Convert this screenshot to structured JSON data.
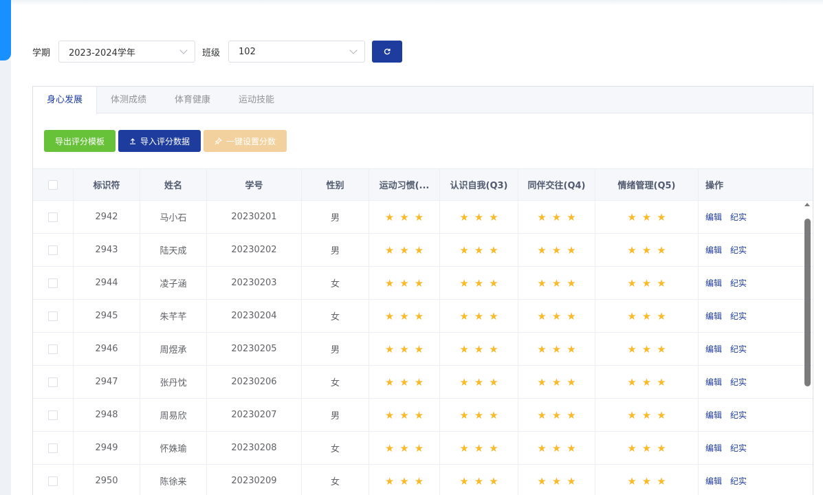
{
  "filters": {
    "term_label": "学期",
    "term_value": "2023-2024学年",
    "class_label": "班级",
    "class_value": "102",
    "refresh_icon": "refresh-icon"
  },
  "tabs": [
    {
      "label": "身心发展",
      "active": true
    },
    {
      "label": "体测成绩",
      "active": false
    },
    {
      "label": "体育健康",
      "active": false
    },
    {
      "label": "运动技能",
      "active": false
    }
  ],
  "actions": {
    "export_label": "导出评分模板",
    "import_label": "导入评分数据",
    "bulk_label": "一键设置分数"
  },
  "table": {
    "headers": [
      "标识符",
      "姓名",
      "学号",
      "性别",
      "运动习惯(...",
      "认识自我(Q3)",
      "同伴交往(Q4)",
      "情绪管理(Q5)",
      "操作"
    ],
    "edit_label": "编辑",
    "record_label": "纪实",
    "rows": [
      {
        "id": "2942",
        "name": "马小石",
        "sno": "20230201",
        "gender": "男",
        "q2": 3,
        "q3": 3,
        "q4": 3,
        "q5": 3
      },
      {
        "id": "2943",
        "name": "陆天成",
        "sno": "20230202",
        "gender": "男",
        "q2": 3,
        "q3": 3,
        "q4": 3,
        "q5": 3
      },
      {
        "id": "2944",
        "name": "凌子涵",
        "sno": "20230203",
        "gender": "女",
        "q2": 3,
        "q3": 3,
        "q4": 3,
        "q5": 3
      },
      {
        "id": "2945",
        "name": "朱芊芊",
        "sno": "20230204",
        "gender": "女",
        "q2": 3,
        "q3": 3,
        "q4": 3,
        "q5": 3
      },
      {
        "id": "2946",
        "name": "周煜承",
        "sno": "20230205",
        "gender": "男",
        "q2": 3,
        "q3": 3,
        "q4": 3,
        "q5": 3
      },
      {
        "id": "2947",
        "name": "张丹忱",
        "sno": "20230206",
        "gender": "女",
        "q2": 3,
        "q3": 3,
        "q4": 3,
        "q5": 3
      },
      {
        "id": "2948",
        "name": "周易欣",
        "sno": "20230207",
        "gender": "男",
        "q2": 3,
        "q3": 3,
        "q4": 3,
        "q5": 3
      },
      {
        "id": "2949",
        "name": "怀姝瑜",
        "sno": "20230208",
        "gender": "女",
        "q2": 3,
        "q3": 3,
        "q4": 3,
        "q5": 3
      },
      {
        "id": "2950",
        "name": "陈徐来",
        "sno": "20230209",
        "gender": "女",
        "q2": 3,
        "q3": 3,
        "q4": 3,
        "q5": 3
      }
    ]
  },
  "colors": {
    "primary": "#1d3c9e",
    "success": "#67c23a",
    "warning_light": "#f3d19e",
    "star": "#f7ba2a"
  }
}
